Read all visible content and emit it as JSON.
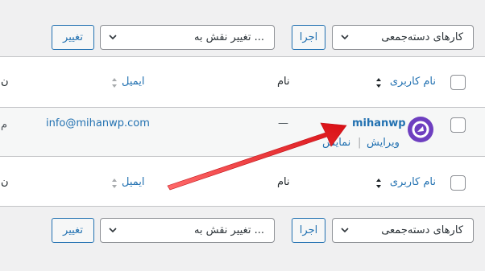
{
  "top_bar": {
    "bulk_actions_label": "کارهای دسته‌جمعی",
    "apply_label": "اجرا",
    "change_role_label": "تغییر نقش به ...",
    "change_label": "تغییر"
  },
  "bottom_bar": {
    "bulk_actions_label": "کارهای دسته‌جمعی",
    "apply_label": "اجرا",
    "change_role_label": "تغییر نقش به ...",
    "change_label": "تغییر"
  },
  "table": {
    "header": {
      "username": "نام کاربری",
      "name": "نام",
      "email": "ایمیل",
      "role_partial": "ن"
    },
    "footer": {
      "username": "نام کاربری",
      "name": "نام",
      "email": "ایمیل",
      "role_partial": "ن"
    },
    "rows": [
      {
        "username": "mihanwp",
        "name": "—",
        "email": "info@mihanwp.com",
        "role_partial": "م",
        "actions": {
          "edit": "ویرایش",
          "separator": "|",
          "view": "نمایش"
        }
      }
    ]
  },
  "colors": {
    "accent": "#2271b1",
    "arrow": "#e5161b",
    "avatar_bg": "#6e3fc0"
  },
  "icons": [
    "chevron-down-icon",
    "sort-arrows-icon",
    "avatar-logo-icon",
    "red-arrow-annotation"
  ]
}
